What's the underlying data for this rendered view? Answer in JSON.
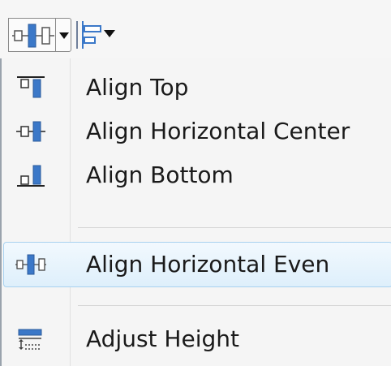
{
  "toolbar": {
    "distribute_button_icon": "align-horizontal-even-icon",
    "dropdown_arrow_icon": "dropdown-arrow-icon",
    "align_button_icon": "align-left-icon"
  },
  "menu": {
    "items": [
      {
        "label": "Align Top",
        "icon": "align-top-icon"
      },
      {
        "label": "Align Horizontal Center",
        "icon": "align-horizontal-center-icon"
      },
      {
        "label": "Align Bottom",
        "icon": "align-bottom-icon"
      },
      {
        "label": "Align Horizontal Even",
        "icon": "align-horizontal-even-icon",
        "highlighted": true
      },
      {
        "label": "Adjust Height",
        "icon": "adjust-height-icon"
      }
    ]
  },
  "colors": {
    "icon_blue": "#3b78c8",
    "highlight_border": "#a8d2f0",
    "highlight_fill": "#deeffb"
  }
}
